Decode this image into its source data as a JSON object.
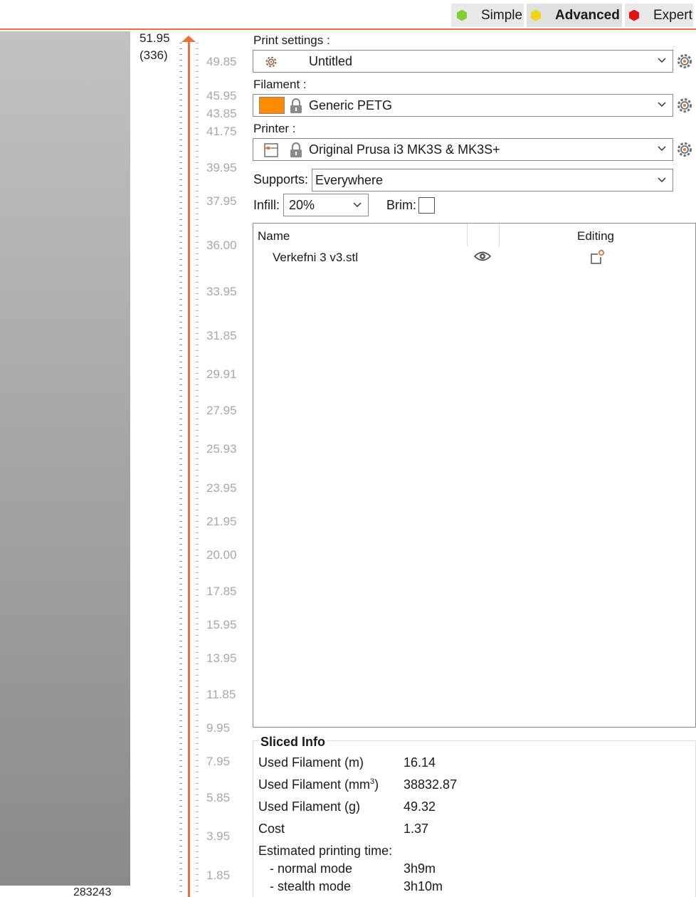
{
  "modes": {
    "simple": {
      "label": "Simple",
      "color": "#7fd22f"
    },
    "advanced": {
      "label": "Advanced",
      "color": "#f2d414"
    },
    "expert": {
      "label": "Expert",
      "color": "#e01414"
    }
  },
  "slider": {
    "top_value": "51.95",
    "top_count": "(336)",
    "bottom_value": "283243",
    "accent_color": "#e8733a",
    "labels": [
      "49.85",
      "45.95",
      "43.85",
      "41.75",
      "39.95",
      "37.95",
      "36.00",
      "33.95",
      "31.85",
      "29.91",
      "27.95",
      "25.93",
      "23.95",
      "21.95",
      "20.00",
      "17.85",
      "15.95",
      "13.95",
      "11.85",
      "9.95",
      "7.95",
      "5.85",
      "3.95",
      "1.85"
    ]
  },
  "print_settings": {
    "label": "Print settings :",
    "value": "Untitled"
  },
  "filament": {
    "label": "Filament :",
    "value": "Generic PETG",
    "swatch_color": "#ff8c00"
  },
  "printer": {
    "label": "Printer :",
    "value": "Original Prusa i3 MK3S & MK3S+"
  },
  "supports": {
    "label": "Supports:",
    "value": "Everywhere"
  },
  "infill": {
    "label": "Infill:",
    "value": "20%"
  },
  "brim": {
    "label": "Brim:",
    "checked": false
  },
  "object_list": {
    "columns": {
      "name": "Name",
      "editing": "Editing"
    },
    "objects": [
      {
        "name": "Verkefni 3 v3.stl",
        "visible": true
      }
    ]
  },
  "sliced_info": {
    "title": "Sliced Info",
    "rows": [
      {
        "key": "Used Filament (m)",
        "value": "16.14"
      },
      {
        "key": "Used Filament (mm",
        "key_sup": "3",
        "key_after": ")",
        "value": "38832.87"
      },
      {
        "key": "Used Filament (g)",
        "value": "49.32"
      },
      {
        "key": "Cost",
        "value": "1.37"
      }
    ],
    "time_label": "Estimated printing time:",
    "times": [
      {
        "mode": "- normal mode",
        "value": "3h9m"
      },
      {
        "mode": "- stealth mode",
        "value": "3h10m"
      }
    ]
  }
}
